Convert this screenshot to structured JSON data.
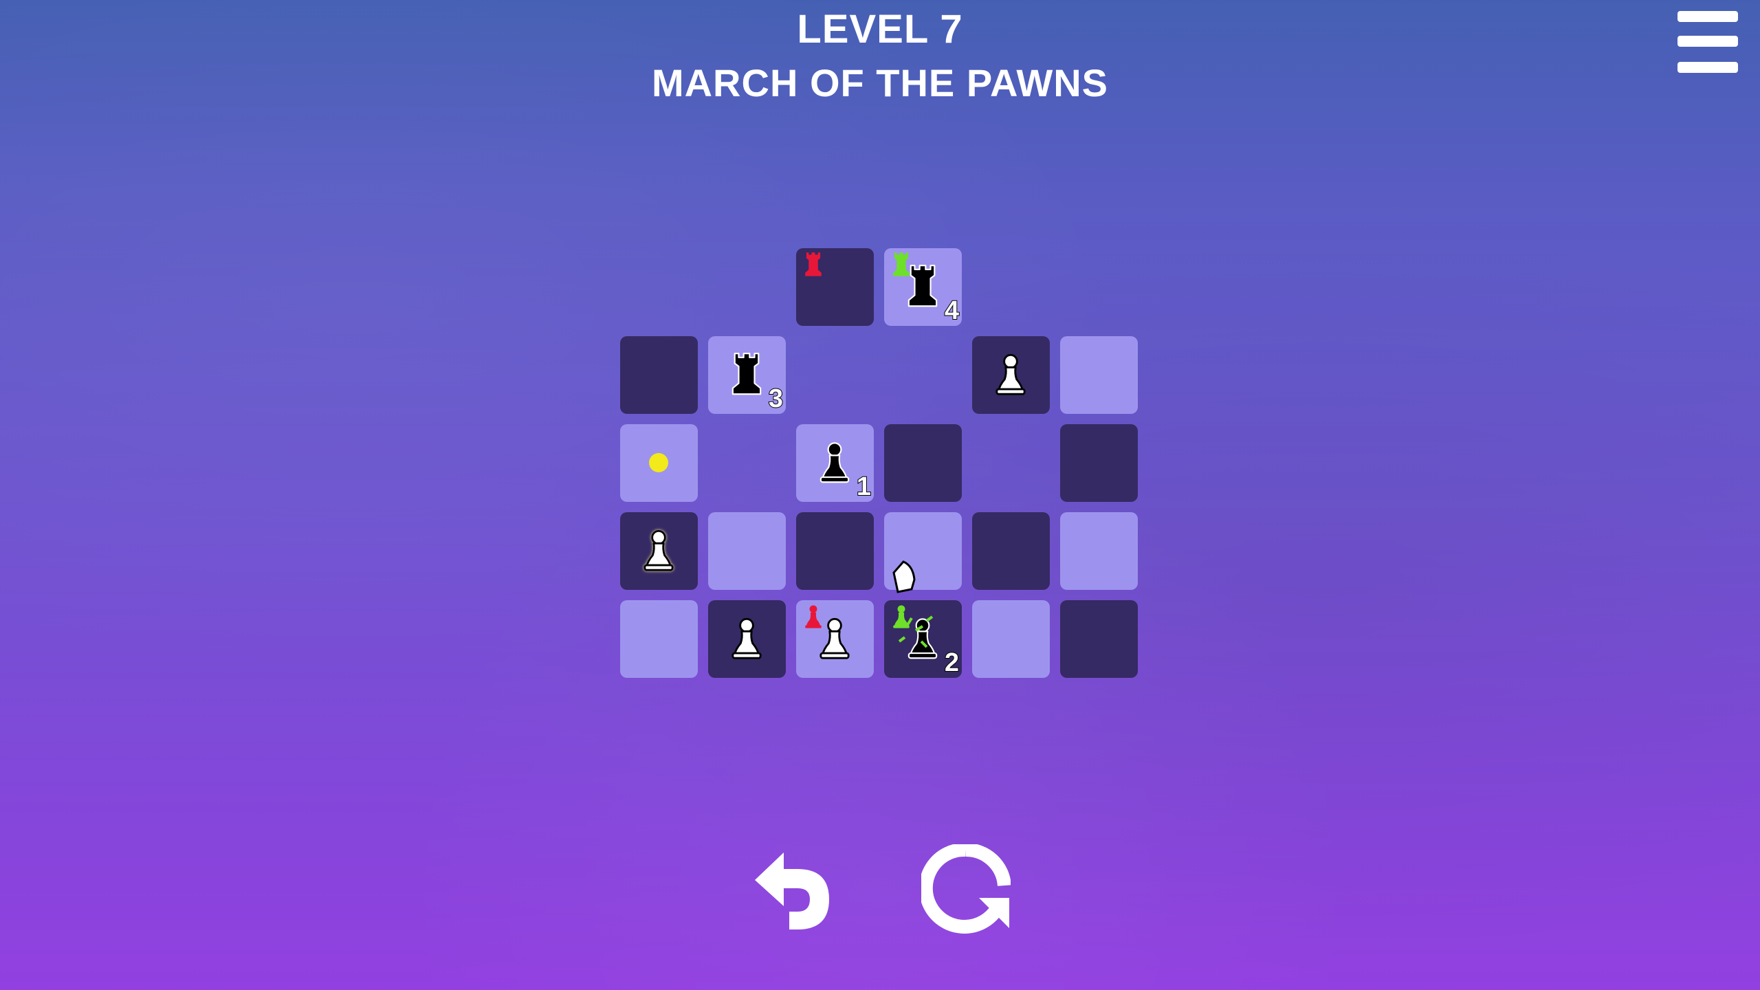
{
  "header": {
    "level_title": "LEVEL 7",
    "level_name": "MARCH OF THE PAWNS"
  },
  "menu": {
    "icon": "hamburger-menu-icon"
  },
  "board": {
    "rows": 5,
    "cols": 6,
    "cells": [
      {
        "row": 0,
        "col": 2,
        "shade": "dark",
        "pieces": [
          {
            "type": "rook",
            "color": "red",
            "size": "small"
          }
        ]
      },
      {
        "row": 0,
        "col": 3,
        "shade": "light",
        "pieces": [
          {
            "type": "rook",
            "color": "green",
            "size": "small"
          },
          {
            "type": "rook",
            "color": "black",
            "size": "large",
            "count": "4"
          }
        ]
      },
      {
        "row": 1,
        "col": 0,
        "shade": "dark",
        "pieces": []
      },
      {
        "row": 1,
        "col": 1,
        "shade": "light",
        "pieces": [
          {
            "type": "rook",
            "color": "black",
            "size": "large",
            "count": "3"
          }
        ]
      },
      {
        "row": 1,
        "col": 4,
        "shade": "dark",
        "pieces": [
          {
            "type": "pawn",
            "color": "white",
            "size": "large"
          }
        ]
      },
      {
        "row": 1,
        "col": 5,
        "shade": "light",
        "pieces": []
      },
      {
        "row": 2,
        "col": 0,
        "shade": "light",
        "pieces": [],
        "target": true
      },
      {
        "row": 2,
        "col": 2,
        "shade": "light",
        "pieces": [
          {
            "type": "pawn",
            "color": "black",
            "size": "large",
            "count": "1"
          }
        ]
      },
      {
        "row": 2,
        "col": 3,
        "shade": "dark",
        "pieces": []
      },
      {
        "row": 2,
        "col": 5,
        "shade": "dark",
        "pieces": []
      },
      {
        "row": 3,
        "col": 0,
        "shade": "dark",
        "pieces": [
          {
            "type": "pawn",
            "color": "white",
            "size": "large",
            "selected": true
          }
        ]
      },
      {
        "row": 3,
        "col": 1,
        "shade": "light",
        "pieces": []
      },
      {
        "row": 3,
        "col": 2,
        "shade": "dark",
        "pieces": []
      },
      {
        "row": 3,
        "col": 3,
        "shade": "light",
        "pieces": []
      },
      {
        "row": 3,
        "col": 4,
        "shade": "dark",
        "pieces": []
      },
      {
        "row": 3,
        "col": 5,
        "shade": "light",
        "pieces": []
      },
      {
        "row": 4,
        "col": 0,
        "shade": "light",
        "pieces": []
      },
      {
        "row": 4,
        "col": 1,
        "shade": "dark",
        "pieces": [
          {
            "type": "pawn",
            "color": "white",
            "size": "large"
          }
        ]
      },
      {
        "row": 4,
        "col": 2,
        "shade": "light",
        "pieces": [
          {
            "type": "pawn",
            "color": "red",
            "size": "small"
          },
          {
            "type": "pawn",
            "color": "white",
            "size": "large"
          }
        ]
      },
      {
        "row": 4,
        "col": 3,
        "shade": "dark",
        "pieces": [
          {
            "type": "pawn",
            "color": "green",
            "size": "small"
          },
          {
            "type": "pawn",
            "color": "black",
            "size": "large",
            "count": "2",
            "capture": true
          }
        ]
      },
      {
        "row": 4,
        "col": 4,
        "shade": "light",
        "pieces": []
      },
      {
        "row": 4,
        "col": 5,
        "shade": "dark",
        "pieces": []
      }
    ]
  },
  "controls": {
    "undo": {
      "icon": "undo-arrow-icon"
    },
    "restart": {
      "icon": "restart-icon"
    }
  },
  "colors": {
    "dark_cell": "#352a63",
    "light_cell": "#9d93ee",
    "target_dot": "#f2ea1a",
    "red_piece": "#e8173a",
    "green_piece": "#6ee02a"
  }
}
